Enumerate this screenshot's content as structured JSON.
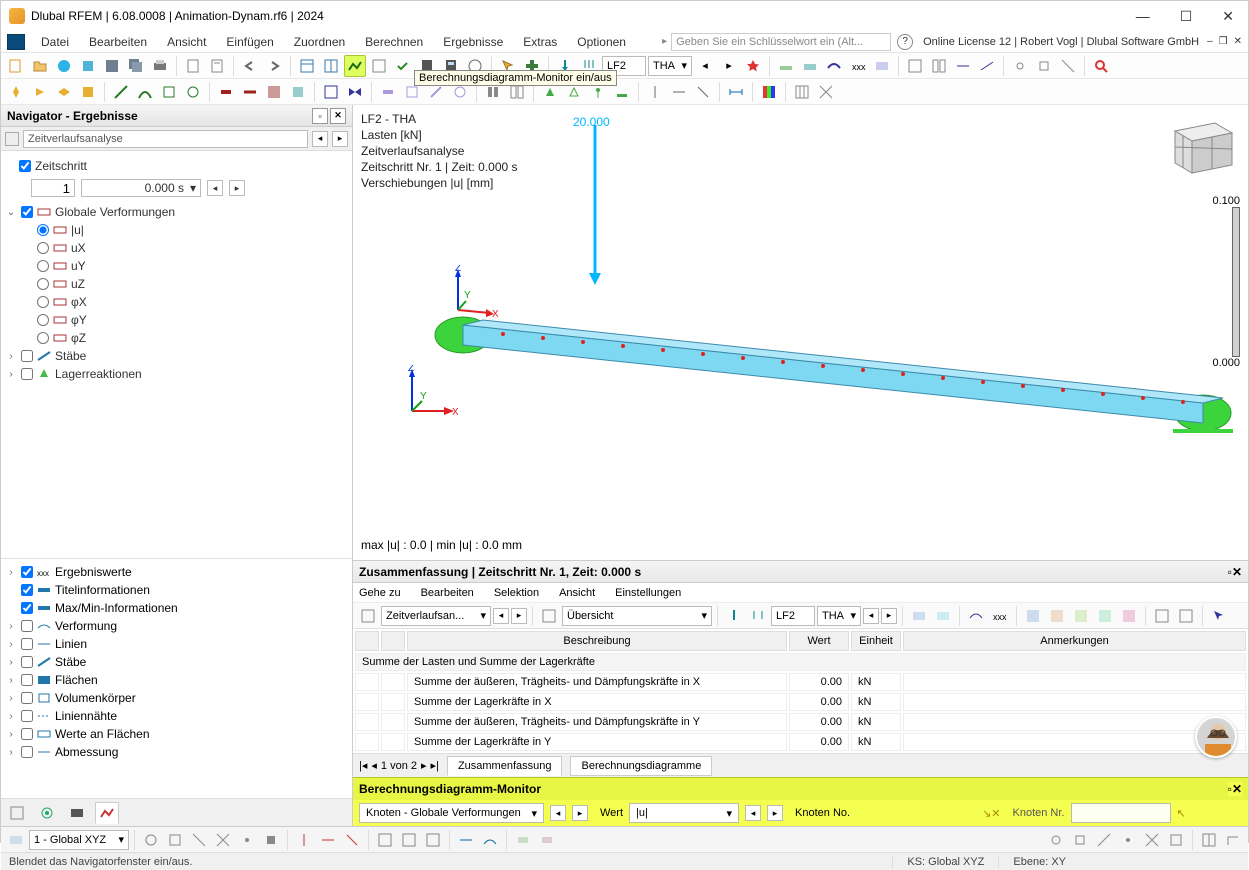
{
  "window": {
    "title": "Dlubal RFEM | 6.08.0008 | Animation-Dynam.rf6 | 2024"
  },
  "menu": {
    "items": [
      "Datei",
      "Bearbeiten",
      "Ansicht",
      "Einfügen",
      "Zuordnen",
      "Berechnen",
      "Ergebnisse",
      "Extras",
      "Optionen"
    ],
    "search_placeholder": "Geben Sie ein Schlüsselwort ein (Alt...",
    "license": "Online License 12 | Robert Vogl | Dlubal Software GmbH"
  },
  "tooltip": "Berechnungsdiagramm-Monitor ein/aus",
  "load_case": {
    "lf": "LF2",
    "type": "THA"
  },
  "navigator": {
    "title": "Navigator - Ergebnisse",
    "combo": "Zeitverlaufsanalyse",
    "time_step_label": "Zeitschritt",
    "time_step_num": "1",
    "time_step_val": "0.000 s",
    "tree": {
      "global_def": "Globale Verformungen",
      "items": [
        "|u|",
        "uX",
        "uY",
        "uZ",
        "φX",
        "φY",
        "φZ"
      ],
      "members": "Stäbe",
      "reactions": "Lagerreaktionen"
    },
    "lower_items": [
      "Ergebniswerte",
      "Titelinformationen",
      "Max/Min-Informationen",
      "Verformung",
      "Linien",
      "Stäbe",
      "Flächen",
      "Volumenkörper",
      "Liniennähte",
      "Werte an Flächen",
      "Abmessung"
    ]
  },
  "canvas": {
    "info": [
      "LF2 - THA",
      "Lasten [kN]",
      "Zeitverlaufsanalyse",
      "Zeitschritt Nr. 1 | Zeit: 0.000 s",
      "Verschiebungen |u| [mm]"
    ],
    "load_value": "20.000",
    "scale_top": "0.100",
    "scale_bot": "0.000",
    "minmax": "max |u| : 0.0 | min |u| : 0.0 mm"
  },
  "summary": {
    "title": "Zusammenfassung | Zeitschritt Nr. 1, Zeit: 0.000 s",
    "menu": [
      "Gehe zu",
      "Bearbeiten",
      "Selektion",
      "Ansicht",
      "Einstellungen"
    ],
    "combo1": "Zeitverlaufsan...",
    "combo2": "Übersicht",
    "lf": "LF2",
    "type": "THA",
    "columns": [
      "Beschreibung",
      "Wert",
      "Einheit",
      "Anmerkungen"
    ],
    "group_row": "Summe der Lasten und Summe der Lagerkräfte",
    "rows": [
      {
        "d": "Summe der äußeren, Trägheits- und Dämpfungskräfte in X",
        "w": "0.00",
        "e": "kN"
      },
      {
        "d": "Summe der Lagerkräfte in X",
        "w": "0.00",
        "e": "kN"
      },
      {
        "d": "Summe der äußeren, Trägheits- und Dämpfungskräfte in Y",
        "w": "0.00",
        "e": "kN"
      },
      {
        "d": "Summe der Lagerkräfte in Y",
        "w": "0.00",
        "e": "kN"
      }
    ],
    "pager": "1 von 2",
    "tabs": [
      "Zusammenfassung",
      "Berechnungsdiagramme"
    ]
  },
  "monitor": {
    "title": "Berechnungsdiagramm-Monitor",
    "combo1": "Knoten - Globale Verformungen",
    "label_wert": "Wert",
    "combo2": "|u|",
    "label_knoten": "Knoten No.",
    "input_label": "Knoten Nr."
  },
  "status": {
    "gcs": "1 - Global XYZ"
  },
  "infobar": {
    "hint": "Blendet das Navigatorfenster ein/aus.",
    "ks": "KS: Global XYZ",
    "ebene": "Ebene: XY"
  }
}
